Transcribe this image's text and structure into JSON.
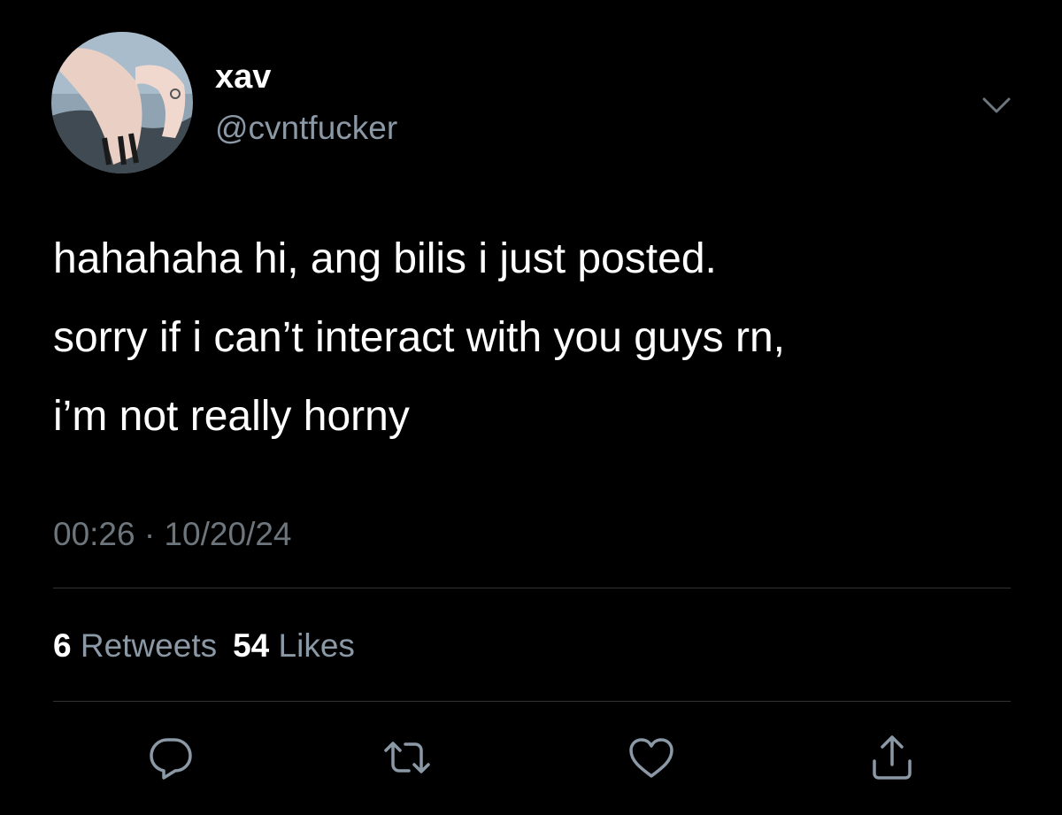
{
  "user": {
    "display_name": "xav",
    "handle": "@cvntfucker"
  },
  "tweet": {
    "text": "hahahaha hi, ang bilis i just posted.\nsorry if i can’t interact with you guys rn,\ni’m not really horny",
    "time": "00:26",
    "separator": "·",
    "date": "10/20/24"
  },
  "stats": {
    "retweets_count": "6",
    "retweets_label": "Retweets",
    "likes_count": "54",
    "likes_label": "Likes"
  },
  "icons": {
    "more": "chevron-down-icon",
    "reply": "reply-icon",
    "retweet": "retweet-icon",
    "like": "heart-icon",
    "share": "share-icon"
  },
  "colors": {
    "background": "#000000",
    "text_primary": "#ffffff",
    "text_secondary": "#8b98a5",
    "divider": "#2f3336",
    "icon": "#8b98a5"
  }
}
